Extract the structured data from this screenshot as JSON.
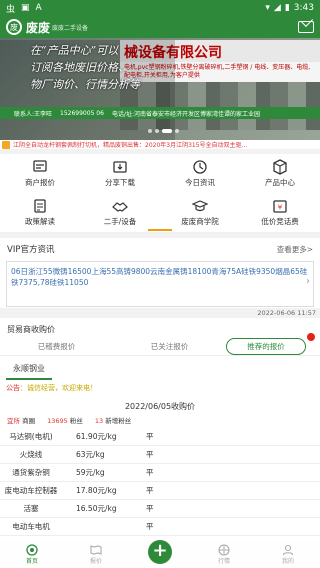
{
  "status_bar": {
    "left_icons": [
      "虫",
      "▣",
      "A"
    ],
    "time": "3:43"
  },
  "app_bar": {
    "logo_char": "废",
    "title": "废废",
    "subtitle": "废废二手设备"
  },
  "banner": {
    "sign_text": "械设备有限公司",
    "sign_sub": "电机,pvc塑钢粉碎机,铁壁分离破碎机,二手塑钢 / 电线、变压器、电缆,配电柜,开关柜用,为客户提供",
    "caption_lines": [
      "在“产品中心”可以",
      "订阅各地废旧价格、",
      "物厂询价、行情分析等"
    ],
    "footer_contact": "联系人:王李旺",
    "footer_phone": "152699005 06",
    "footer_address": "电话/址:河南省泰安市经济开发区博家湾佳谭的家工业园"
  },
  "ticker": {
    "text": "江阴全自动龙杆钢套佩制打切机，精品废铜出售：2020年3月江阴315号全自动双主驱..."
  },
  "nav_grid": [
    {
      "label": "商户报价",
      "icon": "price-tag-icon"
    },
    {
      "label": "分享下载",
      "icon": "share-icon"
    },
    {
      "label": "今日资讯",
      "icon": "clock-icon"
    },
    {
      "label": "产品中心",
      "icon": "cube-icon"
    },
    {
      "label": "政策解读",
      "icon": "document-icon"
    },
    {
      "label": "二手/设备",
      "icon": "handshake-icon"
    },
    {
      "label": "废废商学院",
      "icon": "graduation-icon"
    },
    {
      "label": "低价竞话费",
      "icon": "gift-icon"
    }
  ],
  "vip": {
    "title": "VIP官方资讯",
    "more_label": "查看更多>",
    "content": "06日浙江55微铸16500上海55高铸9800云南金属铸18100青海75A硅铁9350烟晶65硅铁7375,78硅铁11050",
    "date": "2022-06-06 11:57"
  },
  "purchase": {
    "title": "贸易商收购价",
    "tabs": [
      "已稽费报价",
      "已关注报价",
      "推荐的报价"
    ],
    "company": "永顺钢业",
    "notice_label": "公告",
    "notice_text": "诚信经营，欢迎来电！",
    "price_date": "2022/06/05收购价",
    "meta": [
      {
        "label": "宜所",
        "value": "商圈"
      },
      {
        "label": "13695",
        "value": "粉丝"
      },
      {
        "label": "13",
        "value": "新增粉丝"
      }
    ],
    "rows": [
      {
        "name": "马达铜(电机)",
        "price": "61.90元/kg",
        "trend": "平"
      },
      {
        "name": "火烧线",
        "price": "63元/kg",
        "trend": "平"
      },
      {
        "name": "通货紫杂铜",
        "price": "59元/kg",
        "trend": "平"
      },
      {
        "name": "废电动车控制器",
        "price": "17.80元/kg",
        "trend": "平"
      },
      {
        "name": "活塞",
        "price": "16.50元/kg",
        "trend": "平"
      },
      {
        "name": "电动车电机",
        "price": "",
        "trend": "平"
      }
    ]
  },
  "bottom_nav": [
    {
      "label": "首页",
      "active": true
    },
    {
      "label": "报价",
      "active": false
    },
    {
      "label": "",
      "active": false
    },
    {
      "label": "行情",
      "active": false
    },
    {
      "label": "我的",
      "active": false
    }
  ],
  "colors": {
    "primary": "#2e8a3a",
    "accent": "#f39c12",
    "link": "#3a6fb0",
    "alert": "#d33"
  }
}
